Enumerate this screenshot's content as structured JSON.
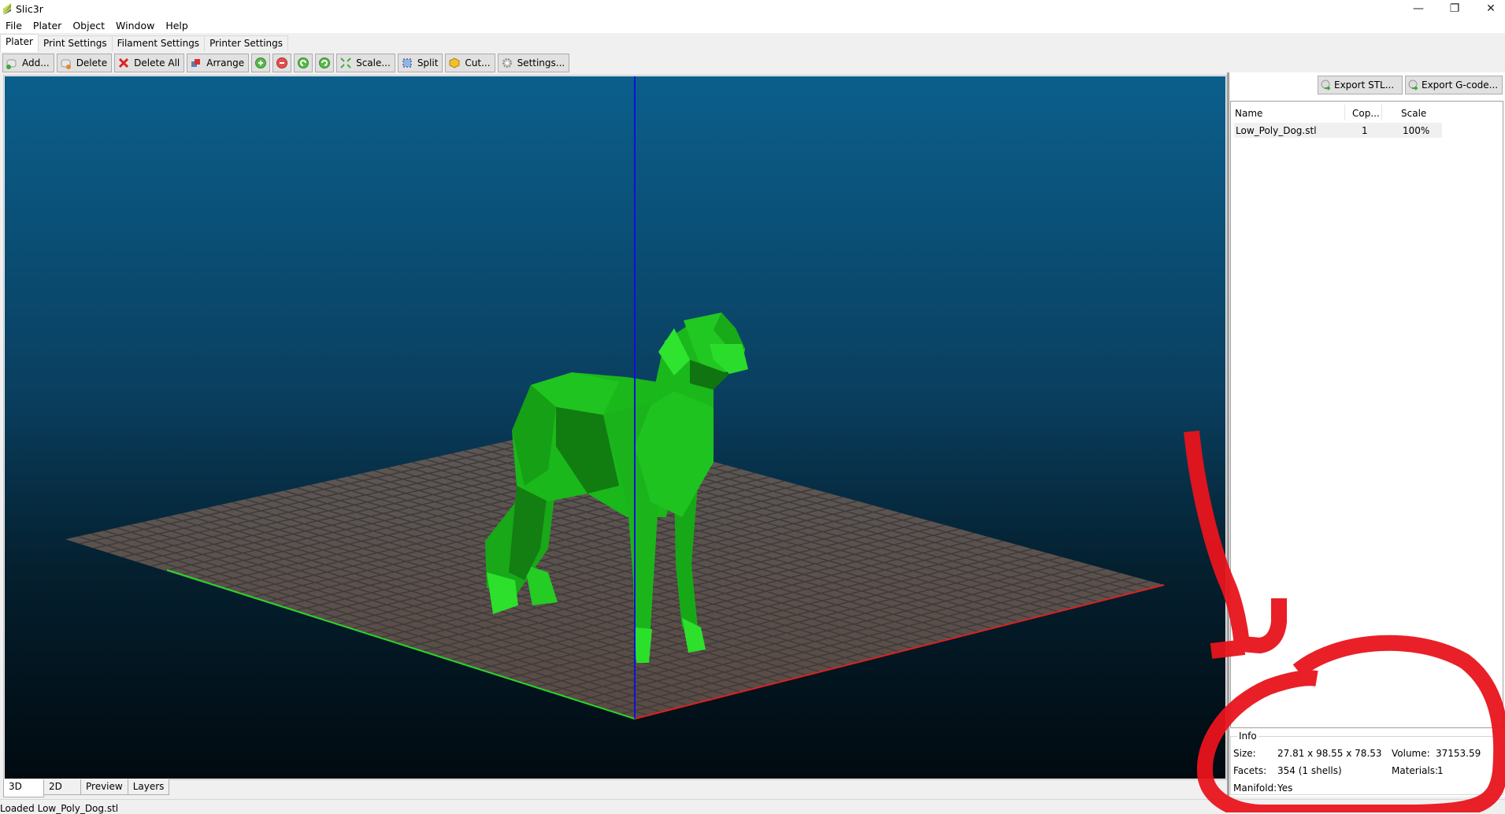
{
  "window": {
    "title": "Slic3r",
    "controls": {
      "minimize": "—",
      "restore": "❐",
      "close": "✕"
    }
  },
  "menu": [
    "File",
    "Plater",
    "Object",
    "Window",
    "Help"
  ],
  "tabs": [
    {
      "label": "Plater",
      "active": true
    },
    {
      "label": "Print Settings",
      "active": false
    },
    {
      "label": "Filament Settings",
      "active": false
    },
    {
      "label": "Printer Settings",
      "active": false
    }
  ],
  "toolbar": {
    "add": "Add...",
    "delete": "Delete",
    "delete_all": "Delete All",
    "arrange": "Arrange",
    "more_icon": "plus-circle-icon",
    "fewer_icon": "minus-circle-icon",
    "rotate_left_icon": "rotate-ccw-icon",
    "rotate_right_icon": "rotate-cw-icon",
    "scale": "Scale...",
    "split": "Split",
    "cut": "Cut...",
    "settings": "Settings..."
  },
  "viewport": {
    "model_color": "#1fc91f",
    "bed_color": "#5a524f",
    "x_axis_color": "#e0201e",
    "y_axis_color": "#27d827",
    "z_axis_color": "#1010e0"
  },
  "right_panel": {
    "export_stl": "Export STL...",
    "export_gcode": "Export G-code...",
    "columns": [
      "Name",
      "Cop...",
      "Scale"
    ],
    "objects": [
      {
        "name": "Low_Poly_Dog.stl",
        "copies": "1",
        "scale": "100%"
      }
    ]
  },
  "info": {
    "title": "Info",
    "size_label": "Size:",
    "size_value": "27.81 x 98.55 x 78.53",
    "volume_label": "Volume:",
    "volume_value": "37153.59",
    "facets_label": "Facets:",
    "facets_value": "354 (1 shells)",
    "materials_label": "Materials:",
    "materials_value": "1",
    "manifold_label": "Manifold:",
    "manifold_value": "Yes"
  },
  "bottom_tabs": [
    "3D",
    "2D",
    "Preview",
    "Layers"
  ],
  "status": "Loaded Low_Poly_Dog.stl",
  "annotation_color": "#e8141c"
}
